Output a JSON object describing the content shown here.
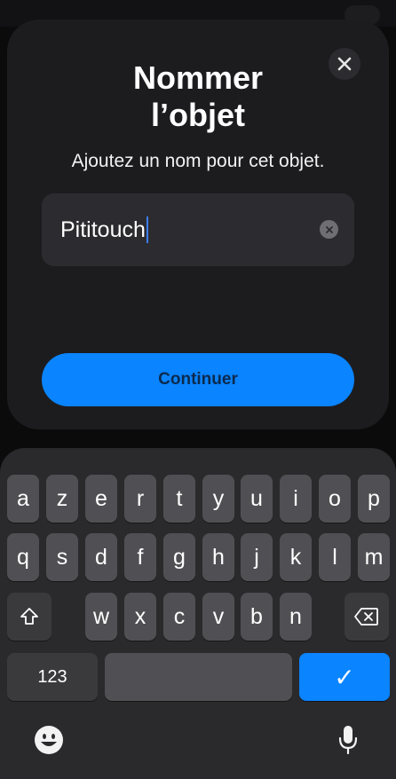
{
  "dialog": {
    "title": "Nommer\nl’objet",
    "subtitle": "Ajoutez un nom pour cet objet.",
    "input_value": "Pititouch",
    "continue_label": "Continuer"
  },
  "keyboard": {
    "row1": [
      "a",
      "z",
      "e",
      "r",
      "t",
      "y",
      "u",
      "i",
      "o",
      "p"
    ],
    "row2": [
      "q",
      "s",
      "d",
      "f",
      "g",
      "h",
      "j",
      "k",
      "l",
      "m"
    ],
    "row3": [
      "w",
      "x",
      "c",
      "v",
      "b",
      "n"
    ],
    "numbers_label": "123",
    "confirm_symbol": "✓",
    "icons": {
      "shift": "shift-icon",
      "delete": "delete-icon",
      "emoji": "emoji-icon",
      "mic": "microphone-icon"
    }
  },
  "colors": {
    "accent": "#0a84ff",
    "sheet": "#1c1c1f",
    "input": "#2c2c30",
    "key": "#505054",
    "key_function": "#3a3a3d"
  }
}
